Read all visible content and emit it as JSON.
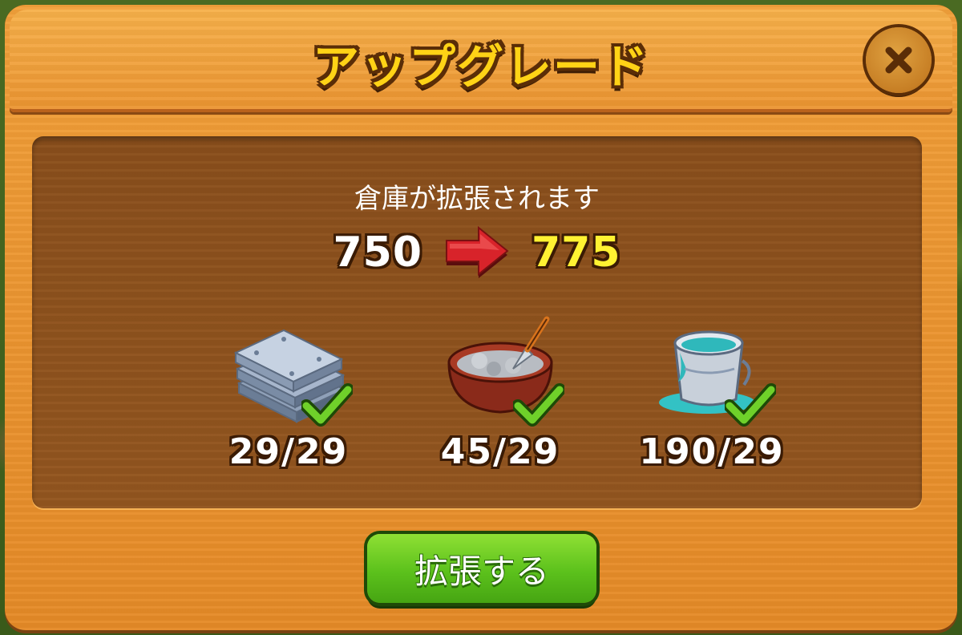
{
  "dialog": {
    "title": "アップグレード",
    "close_icon": "close-icon"
  },
  "upgrade": {
    "description": "倉庫が拡張されます",
    "capacity_from": "750",
    "capacity_to": "775",
    "arrow_icon": "right-arrow-icon"
  },
  "materials": [
    {
      "icon": "metal-plates-icon",
      "count": "29/29",
      "complete": true
    },
    {
      "icon": "cement-bowl-icon",
      "count": "45/29",
      "complete": true
    },
    {
      "icon": "paint-bucket-icon",
      "count": "190/29",
      "complete": true
    }
  ],
  "action": {
    "expand_label": "拡張する"
  },
  "colors": {
    "title_yellow": "#ffd316",
    "capacity_new": "#fff232",
    "button_green": "#5cc11c",
    "check_green": "#6fd12a",
    "arrow_red": "#d8232a"
  }
}
